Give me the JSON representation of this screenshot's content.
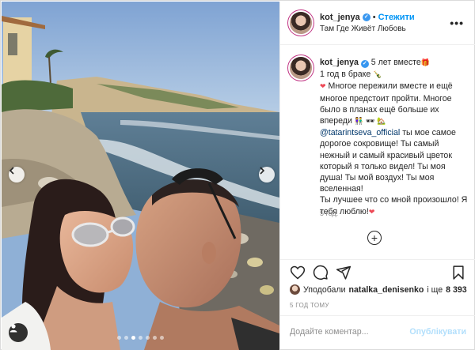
{
  "header": {
    "username": "kot_jenya",
    "separator": "•",
    "follow_label": "Стежити",
    "location": "Там Где Живёт Любовь",
    "more_label": "•••"
  },
  "caption": {
    "username": "kot_jenya",
    "line1_text": "5 лет вместе",
    "line2_text": "1 год в браке",
    "line3_text": "Многое пережили вместе и ещё многое предстоит пройти. Многое было в планах ещё больше их впереди",
    "mention": "@tatarintseva_official",
    "line4_text": "ты мое самое дорогое сокровище! Ты самый нежный и самый красивый цветок который я только видел! Ты моя душа! Ты мой воздух! Ты моя вселенная!",
    "line5_text": "Ты лучшее что со мной произошло! Я тебя люблю!",
    "emoji_gift": "🎁",
    "emoji_bottle": "🍾",
    "emoji_heart": "❤",
    "emoji_couple": "👫",
    "emoji_glasses": "🕶",
    "emoji_house": "🏡",
    "emoji_heart_end": "❤"
  },
  "comment_time": "5 год.",
  "load_more_label": "+",
  "likes": {
    "prefix": "Уподобали",
    "user": "natalka_denisenko",
    "middle": "і ще",
    "count": "8 393"
  },
  "post_date": "5 ГОД ТОМУ",
  "add_comment": {
    "placeholder": "Додайте коментар...",
    "publish_label": "Опублікувати"
  },
  "photo": {
    "carousel_total": 7,
    "carousel_active": 3
  },
  "colors": {
    "link": "#0095f6",
    "mention": "#00376b",
    "heart": "#ed4956",
    "muted": "#8e8e8e",
    "publish_disabled": "#b2dffc"
  }
}
